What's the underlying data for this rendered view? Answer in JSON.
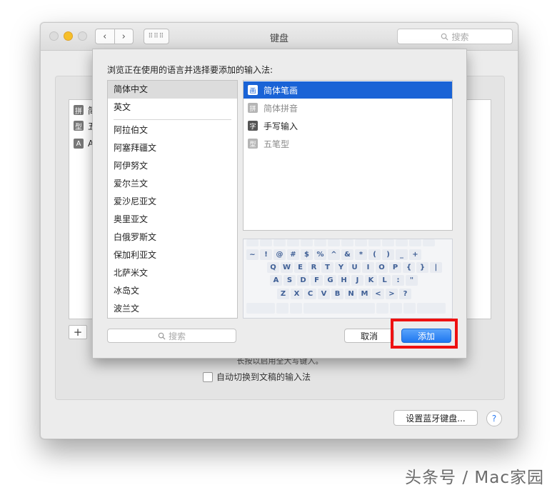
{
  "window": {
    "title": "键盘",
    "search_placeholder": "搜索",
    "nav_back": "‹",
    "nav_forward": "›",
    "grid_glyph": "⠿⠿⠿"
  },
  "background": {
    "list_items": [
      {
        "icon": "拼",
        "label": "简"
      },
      {
        "icon": "型",
        "label": "五"
      },
      {
        "icon": "A",
        "label": "A"
      }
    ],
    "plus_label": "+",
    "hint_text": "长按以启用全大写键入。",
    "auto_switch_label": "自动切换到文稿的输入法",
    "bluetooth_button": "设置蓝牙键盘...",
    "help_button": "?"
  },
  "sheet": {
    "title": "浏览正在使用的语言并选择要添加的输入法:",
    "languages": [
      "简体中文",
      "英文",
      "阿拉伯文",
      "阿塞拜疆文",
      "阿伊努文",
      "爱尔兰文",
      "爱沙尼亚文",
      "奥里亚文",
      "白俄罗斯文",
      "保加利亚文",
      "北萨米文",
      "冰岛文",
      "波兰文"
    ],
    "input_methods": [
      {
        "icon": "画",
        "label": "简体笔画",
        "state": "selected"
      },
      {
        "icon": "拼",
        "label": "简体拼音",
        "state": "dim"
      },
      {
        "icon": "字",
        "label": "手写输入",
        "state": "normal"
      },
      {
        "icon": "型",
        "label": "五笔型",
        "state": "dim"
      }
    ],
    "keyboard_rows": [
      [
        "~",
        "!",
        "@",
        "#",
        "$",
        "%",
        "^",
        "&",
        "*",
        "(",
        ")",
        "_",
        "+"
      ],
      [
        "Q",
        "W",
        "E",
        "R",
        "T",
        "Y",
        "U",
        "I",
        "O",
        "P",
        "{",
        "}",
        "|"
      ],
      [
        "A",
        "S",
        "D",
        "F",
        "G",
        "H",
        "J",
        "K",
        "L",
        ":",
        "\""
      ],
      [
        "Z",
        "X",
        "C",
        "V",
        "B",
        "N",
        "M",
        "<",
        ">",
        "?"
      ]
    ],
    "search_placeholder": "搜索",
    "cancel_label": "取消",
    "add_label": "添加"
  },
  "watermark": "头条号 / Mac家园",
  "colors": {
    "selection_blue": "#1a63d6",
    "highlight_red": "#ee1010",
    "traffic_yellow": "#f6bf2a"
  }
}
